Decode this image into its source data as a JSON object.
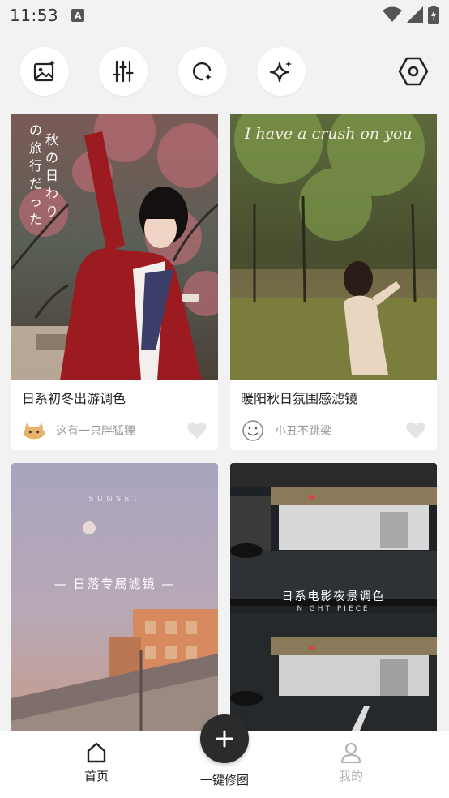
{
  "status_bar": {
    "time": "11:53",
    "notification_badge": "A"
  },
  "toolbar": {
    "icons": [
      "image-icon",
      "sliders-icon",
      "lasso-icon",
      "sparkle-icon",
      "hexagon-settings-icon"
    ]
  },
  "feed": {
    "cards": [
      {
        "title": "日系初冬出游调色",
        "author": "这有一只胖狐狸",
        "overlay_vertical": [
          "の",
          "秋",
          "の",
          "日",
          "わ",
          "り"
        ],
        "overlay_vertical2": [
          "旅",
          "行",
          "だ",
          "っ",
          "た"
        ]
      },
      {
        "title": "暖阳秋日氛围感滤镜",
        "author": "小丑不跳梁",
        "overlay_script": "I have a crush on you"
      },
      {
        "title": "日落专属滤镜",
        "overlay_top": "SUNSET",
        "overlay_center": "— 日落专属滤镜 —"
      },
      {
        "title": "日系电影夜景调色",
        "overlay_center": "日系电影夜景调色",
        "overlay_sub": "NIGHT PIECE"
      }
    ]
  },
  "bottom_nav": {
    "home_label": "首页",
    "edit_label": "一键修图",
    "mine_label": "我的"
  },
  "colors": {
    "active": "#222222",
    "inactive": "#b5b5b5",
    "fab": "#2b2b2b"
  }
}
